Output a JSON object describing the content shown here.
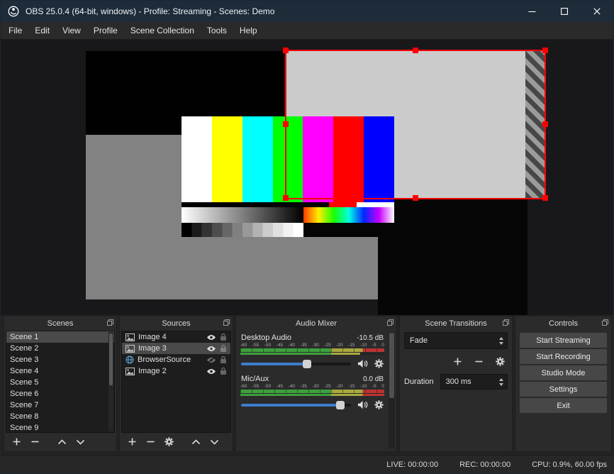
{
  "window": {
    "title": "OBS 25.0.4 (64-bit, windows) - Profile: Streaming - Scenes: Demo"
  },
  "menu_bar": {
    "items": [
      "File",
      "Edit",
      "View",
      "Profile",
      "Scene Collection",
      "Tools",
      "Help"
    ]
  },
  "scenes_panel": {
    "title": "Scenes",
    "selected": "Scene 1",
    "items": [
      "Scene 1",
      "Scene 2",
      "Scene 3",
      "Scene 4",
      "Scene 5",
      "Scene 6",
      "Scene 7",
      "Scene 8",
      "Scene 9"
    ]
  },
  "sources_panel": {
    "title": "Sources",
    "selected": "Image 3",
    "items": [
      {
        "name": "Image 4",
        "icon": "image-icon",
        "visible": true,
        "locked": true
      },
      {
        "name": "Image 3",
        "icon": "image-icon",
        "visible": true,
        "locked": true
      },
      {
        "name": "BrowserSource",
        "icon": "globe-icon",
        "visible": false,
        "locked": true
      },
      {
        "name": "Image 2",
        "icon": "image-icon",
        "visible": true,
        "locked": true
      }
    ]
  },
  "audio_mixer_panel": {
    "title": "Audio Mixer",
    "scale_labels": [
      "-60",
      "-55",
      "-50",
      "-45",
      "-40",
      "-35",
      "-30",
      "-25",
      "-20",
      "-15",
      "-10",
      "-5",
      "0"
    ],
    "channels": [
      {
        "name": "Desktop Audio",
        "level": "-10.5 dB",
        "slider_percent": 60,
        "meter_dark_percent": 17
      },
      {
        "name": "Mic/Aux",
        "level": "0.0 dB",
        "slider_percent": 90,
        "meter_dark_percent": 0
      }
    ]
  },
  "transitions_panel": {
    "title": "Scene Transitions",
    "transition": "Fade",
    "duration_label": "Duration",
    "duration": "300 ms"
  },
  "controls_panel": {
    "title": "Controls",
    "buttons": [
      "Start Streaming",
      "Start Recording",
      "Studio Mode",
      "Settings",
      "Exit"
    ]
  },
  "status_bar": {
    "live": "LIVE: 00:00:00",
    "rec": "REC: 00:00:00",
    "cpu": "CPU: 0.9%, 60.00 fps"
  },
  "preview": {
    "selected_source": "Image 3"
  },
  "icons": {
    "titlebar": [
      "obs-logo-icon",
      "minimize-icon",
      "maximize-icon",
      "close-icon"
    ],
    "panel_header": "popout-icon",
    "scenes_toolbar": [
      "add-icon",
      "remove-icon",
      "move-up-icon",
      "move-down-icon"
    ],
    "sources_toolbar": [
      "add-icon",
      "remove-icon",
      "properties-gear-icon",
      "move-up-icon",
      "move-down-icon"
    ],
    "transitions_toolbar": [
      "add-icon",
      "remove-icon",
      "properties-gear-icon"
    ],
    "source_row": [
      "visibility-eye-icon",
      "lock-icon"
    ],
    "mixer_row": [
      "speaker-icon",
      "gear-icon"
    ]
  },
  "colors": {
    "titlebar": "#1e2b39",
    "selection_red": "#ff0000",
    "slider_blue": "#3d7cc9"
  }
}
